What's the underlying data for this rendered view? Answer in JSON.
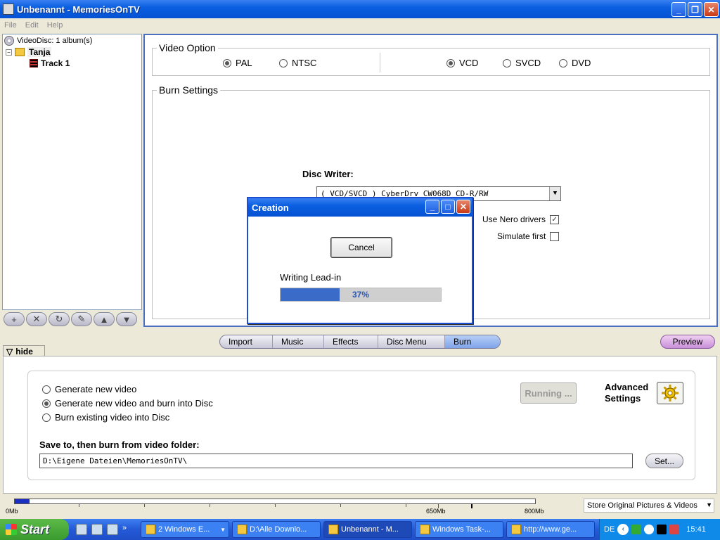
{
  "window": {
    "title": "Unbenannt - MemoriesOnTV"
  },
  "menu": {
    "items": [
      "File",
      "Edit",
      "Help"
    ]
  },
  "tree": {
    "root": "VideoDisc: 1 album(s)",
    "album": "Tanja",
    "track": "Track 1"
  },
  "video_option": {
    "legend": "Video Option",
    "formats": [
      {
        "label": "PAL",
        "selected": true
      },
      {
        "label": "NTSC",
        "selected": false
      }
    ],
    "disc_types": [
      {
        "label": "VCD",
        "selected": true
      },
      {
        "label": "SVCD",
        "selected": false
      },
      {
        "label": "DVD",
        "selected": false
      }
    ]
  },
  "burn_settings": {
    "legend": "Burn Settings",
    "disc_writer_label": "Disc Writer:",
    "disc_writer_value": "( VCD/SVCD ) CyberDrv CW068D CD-R/RW",
    "use_nero_label": "Use Nero drivers",
    "use_nero_checked": true,
    "simulate_label": "Simulate first",
    "simulate_checked": false
  },
  "dialog": {
    "title": "Creation",
    "cancel_label": "Cancel",
    "status": "Writing Lead-in",
    "progress_percent": 37,
    "progress_text": "37%"
  },
  "tabs": [
    {
      "label": "Import",
      "active": false
    },
    {
      "label": "Music",
      "active": false
    },
    {
      "label": "Effects",
      "active": false
    },
    {
      "label": "Disc Menu",
      "active": false
    },
    {
      "label": "Burn",
      "active": true
    }
  ],
  "preview_label": "Preview",
  "hide_label": "hide",
  "bottom": {
    "options": [
      {
        "label": "Generate new video",
        "selected": false
      },
      {
        "label": "Generate new video and burn into Disc",
        "selected": true
      },
      {
        "label": "Burn existing video into Disc",
        "selected": false
      }
    ],
    "running_label": "Running ...",
    "advanced_line1": "Advanced",
    "advanced_line2": "Settings",
    "save_label": "Save to, then burn from video folder:",
    "save_path": "D:\\Eigene Dateien\\MemoriesOnTV\\",
    "set_label": "Set..."
  },
  "capacity": {
    "fill_fraction": 0.028,
    "labels": {
      "start": "0Mb",
      "mid": "650Mb",
      "end": "800Mb"
    },
    "store_option": "Store Original Pictures & Videos"
  },
  "taskbar": {
    "start_label": "Start",
    "tasks": [
      {
        "label": "2 Windows E...",
        "active": false
      },
      {
        "label": "D:\\Alle Downlo...",
        "active": false
      },
      {
        "label": "Unbenannt - M...",
        "active": true
      },
      {
        "label": "Windows Task-...",
        "active": false
      },
      {
        "label": "http://www.ge...",
        "active": false
      }
    ],
    "language": "DE",
    "clock": "15:41"
  },
  "colors": {
    "title_blue": "#0a5fe0",
    "progress_fill": "#3a6bc8",
    "capacity_fill": "#1a2ec0",
    "active_tab": "#7fa4ea",
    "preview_purple": "#c890d8"
  }
}
